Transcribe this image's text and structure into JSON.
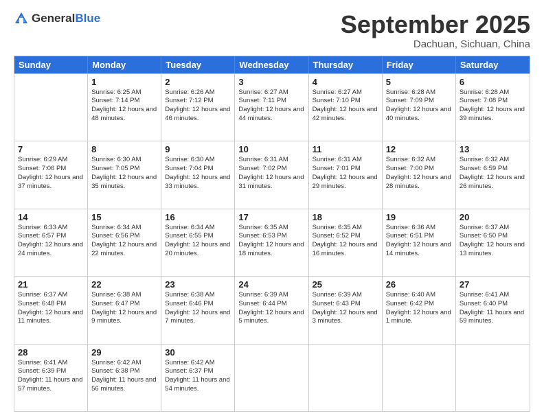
{
  "logo": {
    "general": "General",
    "blue": "Blue"
  },
  "header": {
    "month": "September 2025",
    "location": "Dachuan, Sichuan, China"
  },
  "days": [
    "Sunday",
    "Monday",
    "Tuesday",
    "Wednesday",
    "Thursday",
    "Friday",
    "Saturday"
  ],
  "weeks": [
    [
      {
        "day": "",
        "sunrise": "",
        "sunset": "",
        "daylight": ""
      },
      {
        "day": "1",
        "sunrise": "Sunrise: 6:25 AM",
        "sunset": "Sunset: 7:14 PM",
        "daylight": "Daylight: 12 hours and 48 minutes."
      },
      {
        "day": "2",
        "sunrise": "Sunrise: 6:26 AM",
        "sunset": "Sunset: 7:12 PM",
        "daylight": "Daylight: 12 hours and 46 minutes."
      },
      {
        "day": "3",
        "sunrise": "Sunrise: 6:27 AM",
        "sunset": "Sunset: 7:11 PM",
        "daylight": "Daylight: 12 hours and 44 minutes."
      },
      {
        "day": "4",
        "sunrise": "Sunrise: 6:27 AM",
        "sunset": "Sunset: 7:10 PM",
        "daylight": "Daylight: 12 hours and 42 minutes."
      },
      {
        "day": "5",
        "sunrise": "Sunrise: 6:28 AM",
        "sunset": "Sunset: 7:09 PM",
        "daylight": "Daylight: 12 hours and 40 minutes."
      },
      {
        "day": "6",
        "sunrise": "Sunrise: 6:28 AM",
        "sunset": "Sunset: 7:08 PM",
        "daylight": "Daylight: 12 hours and 39 minutes."
      }
    ],
    [
      {
        "day": "7",
        "sunrise": "Sunrise: 6:29 AM",
        "sunset": "Sunset: 7:06 PM",
        "daylight": "Daylight: 12 hours and 37 minutes."
      },
      {
        "day": "8",
        "sunrise": "Sunrise: 6:30 AM",
        "sunset": "Sunset: 7:05 PM",
        "daylight": "Daylight: 12 hours and 35 minutes."
      },
      {
        "day": "9",
        "sunrise": "Sunrise: 6:30 AM",
        "sunset": "Sunset: 7:04 PM",
        "daylight": "Daylight: 12 hours and 33 minutes."
      },
      {
        "day": "10",
        "sunrise": "Sunrise: 6:31 AM",
        "sunset": "Sunset: 7:02 PM",
        "daylight": "Daylight: 12 hours and 31 minutes."
      },
      {
        "day": "11",
        "sunrise": "Sunrise: 6:31 AM",
        "sunset": "Sunset: 7:01 PM",
        "daylight": "Daylight: 12 hours and 29 minutes."
      },
      {
        "day": "12",
        "sunrise": "Sunrise: 6:32 AM",
        "sunset": "Sunset: 7:00 PM",
        "daylight": "Daylight: 12 hours and 28 minutes."
      },
      {
        "day": "13",
        "sunrise": "Sunrise: 6:32 AM",
        "sunset": "Sunset: 6:59 PM",
        "daylight": "Daylight: 12 hours and 26 minutes."
      }
    ],
    [
      {
        "day": "14",
        "sunrise": "Sunrise: 6:33 AM",
        "sunset": "Sunset: 6:57 PM",
        "daylight": "Daylight: 12 hours and 24 minutes."
      },
      {
        "day": "15",
        "sunrise": "Sunrise: 6:34 AM",
        "sunset": "Sunset: 6:56 PM",
        "daylight": "Daylight: 12 hours and 22 minutes."
      },
      {
        "day": "16",
        "sunrise": "Sunrise: 6:34 AM",
        "sunset": "Sunset: 6:55 PM",
        "daylight": "Daylight: 12 hours and 20 minutes."
      },
      {
        "day": "17",
        "sunrise": "Sunrise: 6:35 AM",
        "sunset": "Sunset: 6:53 PM",
        "daylight": "Daylight: 12 hours and 18 minutes."
      },
      {
        "day": "18",
        "sunrise": "Sunrise: 6:35 AM",
        "sunset": "Sunset: 6:52 PM",
        "daylight": "Daylight: 12 hours and 16 minutes."
      },
      {
        "day": "19",
        "sunrise": "Sunrise: 6:36 AM",
        "sunset": "Sunset: 6:51 PM",
        "daylight": "Daylight: 12 hours and 14 minutes."
      },
      {
        "day": "20",
        "sunrise": "Sunrise: 6:37 AM",
        "sunset": "Sunset: 6:50 PM",
        "daylight": "Daylight: 12 hours and 13 minutes."
      }
    ],
    [
      {
        "day": "21",
        "sunrise": "Sunrise: 6:37 AM",
        "sunset": "Sunset: 6:48 PM",
        "daylight": "Daylight: 12 hours and 11 minutes."
      },
      {
        "day": "22",
        "sunrise": "Sunrise: 6:38 AM",
        "sunset": "Sunset: 6:47 PM",
        "daylight": "Daylight: 12 hours and 9 minutes."
      },
      {
        "day": "23",
        "sunrise": "Sunrise: 6:38 AM",
        "sunset": "Sunset: 6:46 PM",
        "daylight": "Daylight: 12 hours and 7 minutes."
      },
      {
        "day": "24",
        "sunrise": "Sunrise: 6:39 AM",
        "sunset": "Sunset: 6:44 PM",
        "daylight": "Daylight: 12 hours and 5 minutes."
      },
      {
        "day": "25",
        "sunrise": "Sunrise: 6:39 AM",
        "sunset": "Sunset: 6:43 PM",
        "daylight": "Daylight: 12 hours and 3 minutes."
      },
      {
        "day": "26",
        "sunrise": "Sunrise: 6:40 AM",
        "sunset": "Sunset: 6:42 PM",
        "daylight": "Daylight: 12 hours and 1 minute."
      },
      {
        "day": "27",
        "sunrise": "Sunrise: 6:41 AM",
        "sunset": "Sunset: 6:40 PM",
        "daylight": "Daylight: 11 hours and 59 minutes."
      }
    ],
    [
      {
        "day": "28",
        "sunrise": "Sunrise: 6:41 AM",
        "sunset": "Sunset: 6:39 PM",
        "daylight": "Daylight: 11 hours and 57 minutes."
      },
      {
        "day": "29",
        "sunrise": "Sunrise: 6:42 AM",
        "sunset": "Sunset: 6:38 PM",
        "daylight": "Daylight: 11 hours and 56 minutes."
      },
      {
        "day": "30",
        "sunrise": "Sunrise: 6:42 AM",
        "sunset": "Sunset: 6:37 PM",
        "daylight": "Daylight: 11 hours and 54 minutes."
      },
      {
        "day": "",
        "sunrise": "",
        "sunset": "",
        "daylight": ""
      },
      {
        "day": "",
        "sunrise": "",
        "sunset": "",
        "daylight": ""
      },
      {
        "day": "",
        "sunrise": "",
        "sunset": "",
        "daylight": ""
      },
      {
        "day": "",
        "sunrise": "",
        "sunset": "",
        "daylight": ""
      }
    ]
  ]
}
